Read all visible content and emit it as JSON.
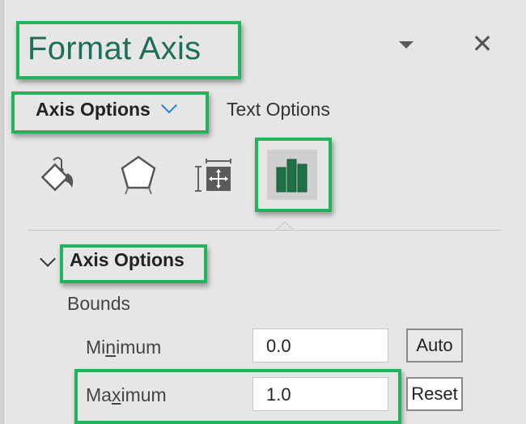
{
  "pane": {
    "title": "Format Axis",
    "menu_icon": "dropdown-triangle-icon",
    "close_icon": "close-x-icon"
  },
  "tabs": [
    {
      "label": "Axis Options",
      "active": true,
      "has_chevron": true
    },
    {
      "label": "Text Options",
      "active": false
    }
  ],
  "icon_tabs": [
    {
      "name": "fill-line-icon",
      "selected": false
    },
    {
      "name": "effects-pentagon-icon",
      "selected": false
    },
    {
      "name": "size-properties-icon",
      "selected": false
    },
    {
      "name": "axis-options-bar-chart-icon",
      "selected": true
    }
  ],
  "section": {
    "title": "Axis Options",
    "expanded": true,
    "group_label": "Bounds",
    "fields": [
      {
        "label_pre": "Mi",
        "label_accel": "n",
        "label_post": "imum",
        "value": "0.0",
        "button": "Auto"
      },
      {
        "label_pre": "Ma",
        "label_accel": "x",
        "label_post": "imum",
        "value": "1.0",
        "button": "Reset"
      }
    ]
  },
  "colors": {
    "highlight": "#22b35e",
    "title_text": "#1f6e5a",
    "chart_icon": "#1e7145",
    "chevron_accent": "#2e7fd0",
    "pane_background": "#e6e6e6"
  }
}
